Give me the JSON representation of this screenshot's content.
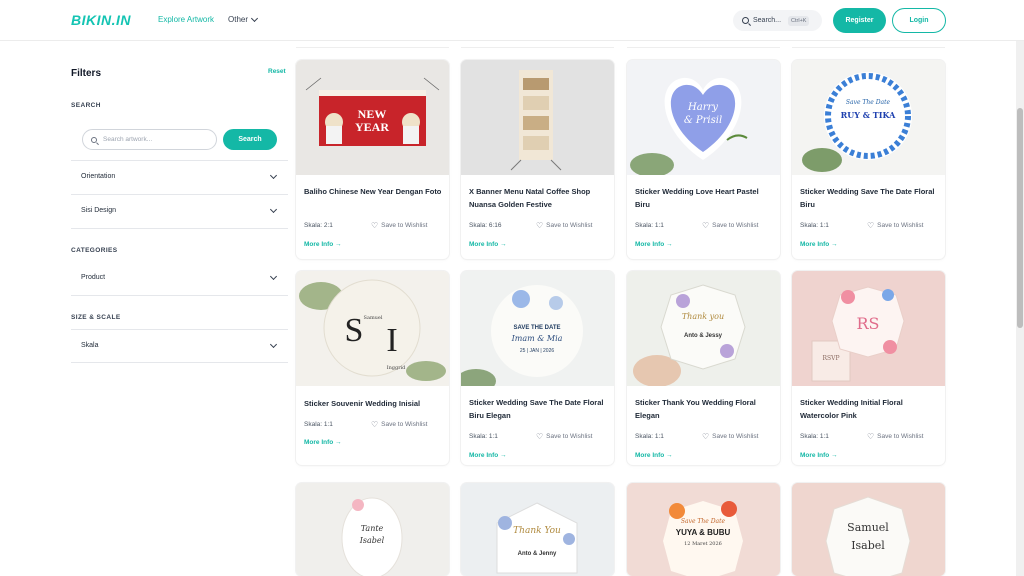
{
  "header": {
    "logo": "BIKIN.IN",
    "nav_explore": "Explore Artwork",
    "nav_other": "Other",
    "search_label": "Search...",
    "search_shortcut": "Ctrl+K",
    "register_label": "Register",
    "login_label": "Login"
  },
  "sidebar": {
    "title": "Filters",
    "reset_label": "Reset",
    "search_section": "SEARCH",
    "search_placeholder": "Search artwork...",
    "search_button": "Search",
    "orientation_label": "Orientation",
    "sisi_label": "Sisi Design",
    "categories_section": "CATEGORIES",
    "product_label": "Product",
    "size_section": "SIZE & SCALE",
    "skala_label": "Skala"
  },
  "card_labels": {
    "wishlist": "Save to Wishlist",
    "more_info": "More Info →"
  },
  "products": [
    {
      "title": "Baliho Chinese New Year Dengan Foto",
      "scale": "Skala: 2:1"
    },
    {
      "title": "X Banner Menu Natal Coffee Shop Nuansa Golden Festive",
      "scale": "Skala: 6:16"
    },
    {
      "title": "Sticker Wedding Love Heart Pastel Biru",
      "scale": "Skala: 1:1"
    },
    {
      "title": "Sticker Wedding Save The Date Floral Biru",
      "scale": "Skala: 1:1"
    },
    {
      "title": "Sticker Souvenir Wedding Inisial",
      "scale": "Skala: 1:1"
    },
    {
      "title": "Sticker Wedding Save The Date Floral Biru Elegan",
      "scale": "Skala: 1:1"
    },
    {
      "title": "Sticker Thank You Wedding Floral Elegan",
      "scale": "Skala: 1:1"
    },
    {
      "title": "Sticker Wedding Initial Floral Watercolor Pink",
      "scale": "Skala: 1:1"
    }
  ],
  "artwork_text": {
    "a1_line": "NEW",
    "a1_line2": "YEAR",
    "a3_line1": "Harry",
    "a3_line2": "& Prisil",
    "a4_line1": "Save The Date",
    "a4_line2": "RUY & TIKA",
    "a5_s": "S",
    "a5_i": "I",
    "a5_name1": "Samuel",
    "a5_name2": "Inggrid",
    "a6_line1": "SAVE THE DATE",
    "a6_line2": "Imam & Mia",
    "a6_line3": "25 | JAN | 2026",
    "a7_line1": "Thank you",
    "a7_line2": "Anto & Jessy",
    "a8_line": "RS",
    "a8_card": "RSVP",
    "b1_line1": "Tante",
    "b1_line2": "Isabel",
    "b2_line1": "Thank You",
    "b2_line2": "Anto & Jenny",
    "b3_line1": "Save The Date",
    "b3_line2": "YUYA & BUBU",
    "b3_line3": "12 Maret 2026",
    "b4_line1": "Samuel",
    "b4_line2": "Isabel"
  },
  "colors": {
    "accent": "#14b8a6",
    "text": "#1f2937"
  }
}
